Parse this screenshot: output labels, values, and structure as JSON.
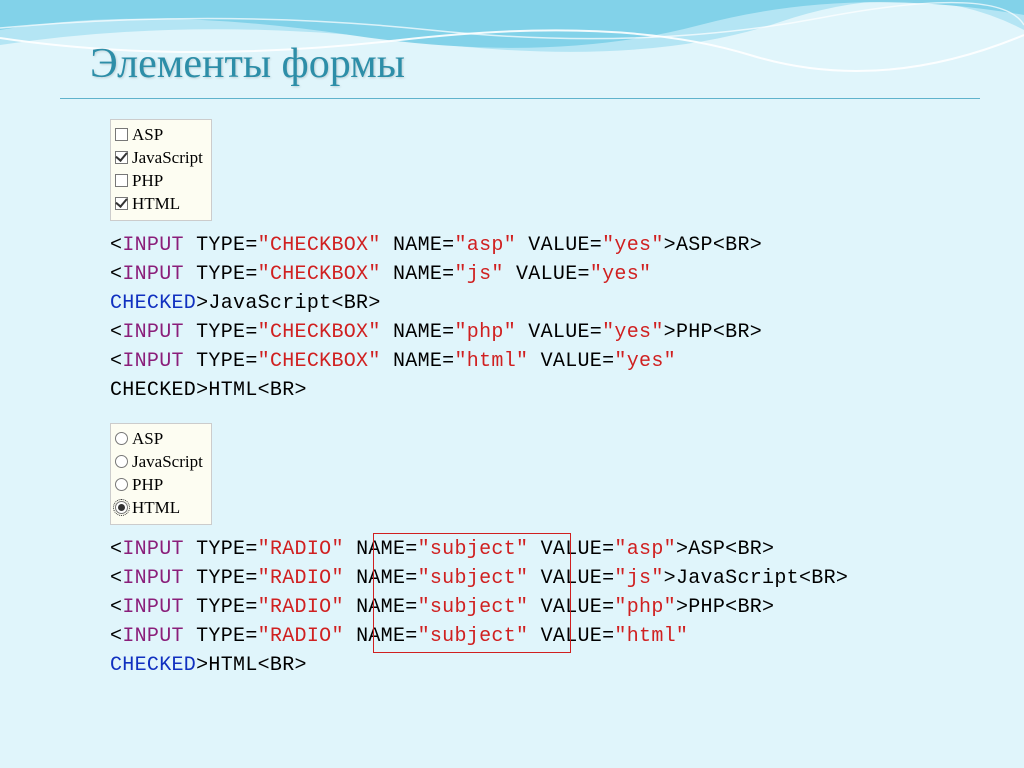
{
  "title": "Элементы формы",
  "checkbox_example": {
    "items": [
      {
        "label": "ASP",
        "checked": false
      },
      {
        "label": "JavaScript",
        "checked": true
      },
      {
        "label": "PHP",
        "checked": false
      },
      {
        "label": "HTML",
        "checked": true
      }
    ]
  },
  "radio_example": {
    "items": [
      {
        "label": "ASP",
        "checked": false
      },
      {
        "label": "JavaScript",
        "checked": false
      },
      {
        "label": "PHP",
        "checked": false
      },
      {
        "label": "HTML",
        "checked": true
      }
    ]
  },
  "code1": {
    "l1": {
      "pre": "<",
      "tag": "INPUT",
      "sp1": " TYPE=",
      "type": "\"CHECKBOX\"",
      "sp2": " NAME=",
      "name": "\"asp\"",
      "sp3": " VALUE=",
      "value": "\"yes\"",
      "post": ">ASP<BR>"
    },
    "l2a": {
      "pre": "<",
      "tag": "INPUT",
      "sp1": " TYPE=",
      "type": "\"CHECKBOX\"",
      "sp2": " NAME=",
      "name": "\"js\"",
      "sp3": " VALUE=",
      "value": "\"yes\""
    },
    "l2b": {
      "checked": "CHECKED",
      "post": ">JavaScript<BR>"
    },
    "l3": {
      "pre": "<",
      "tag": "INPUT",
      "sp1": " TYPE=",
      "type": "\"CHECKBOX\"",
      "sp2": " NAME=",
      "name": "\"php\"",
      "sp3": " VALUE=",
      "value": "\"yes\"",
      "post": ">PHP<BR>"
    },
    "l4a": {
      "pre": "<",
      "tag": "INPUT",
      "sp1": " TYPE=",
      "type": "\"CHECKBOX\"",
      "sp2": " NAME=",
      "name": "\"html\"",
      "sp3": " VALUE=",
      "value": "\"yes\""
    },
    "l4b": {
      "checked": "CHECKED",
      "post": ">HTML<BR>"
    }
  },
  "code2": {
    "l1": {
      "pre": "<",
      "tag": "INPUT",
      "sp1": " TYPE=",
      "type": "\"RADIO\"",
      "sp2": " NAME=",
      "name": "\"subject\"",
      "sp3": " VALUE=",
      "value": "\"asp\"",
      "post": ">ASP<BR>"
    },
    "l2": {
      "pre": "<",
      "tag": "INPUT",
      "sp1": " TYPE=",
      "type": "\"RADIO\"",
      "sp2": " NAME=",
      "name": "\"subject\"",
      "sp3": " VALUE=",
      "value": "\"js\"",
      "post": ">JavaScript<BR>"
    },
    "l3": {
      "pre": "<",
      "tag": "INPUT",
      "sp1": " TYPE=",
      "type": "\"RADIO\"",
      "sp2": " NAME=",
      "name": "\"subject\"",
      "sp3": " VALUE=",
      "value": "\"php\"",
      "post": ">PHP<BR>"
    },
    "l4a": {
      "pre": "<",
      "tag": "INPUT",
      "sp1": " TYPE=",
      "type": "\"RADIO\"",
      "sp2": " NAME=",
      "name": "\"subject\"",
      "sp3": " VALUE=",
      "value": "\"html\""
    },
    "l4b": {
      "checked": "CHECKED",
      "post": ">HTML<BR>"
    }
  }
}
